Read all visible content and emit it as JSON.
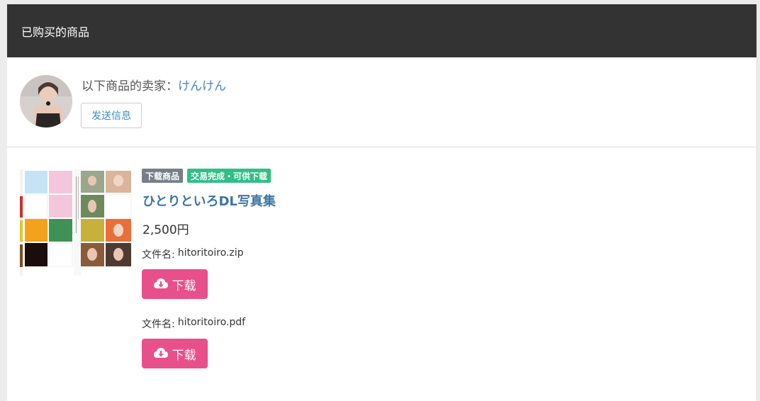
{
  "header": {
    "title": "已购买的商品"
  },
  "seller": {
    "prefix": "以下商品的卖家：",
    "name": "けんけん",
    "message_button": "发送信息"
  },
  "product": {
    "tags": [
      "下载商品",
      "交易完成・可供下载"
    ],
    "title": "ひとりといろDL写真集",
    "price": "2,500円",
    "file_label": "文件名:",
    "files": [
      {
        "name": "hitoritoiro.zip",
        "button": "下载"
      },
      {
        "name": "hitoritoiro.pdf",
        "button": "下载"
      }
    ]
  },
  "colors": {
    "header_bg": "#333333",
    "link": "#3c75a8",
    "tag_download": "#777e8a",
    "tag_complete": "#2fbf87",
    "download_button": "#e8508b"
  },
  "icons": {
    "download": "cloud-download-icon"
  }
}
